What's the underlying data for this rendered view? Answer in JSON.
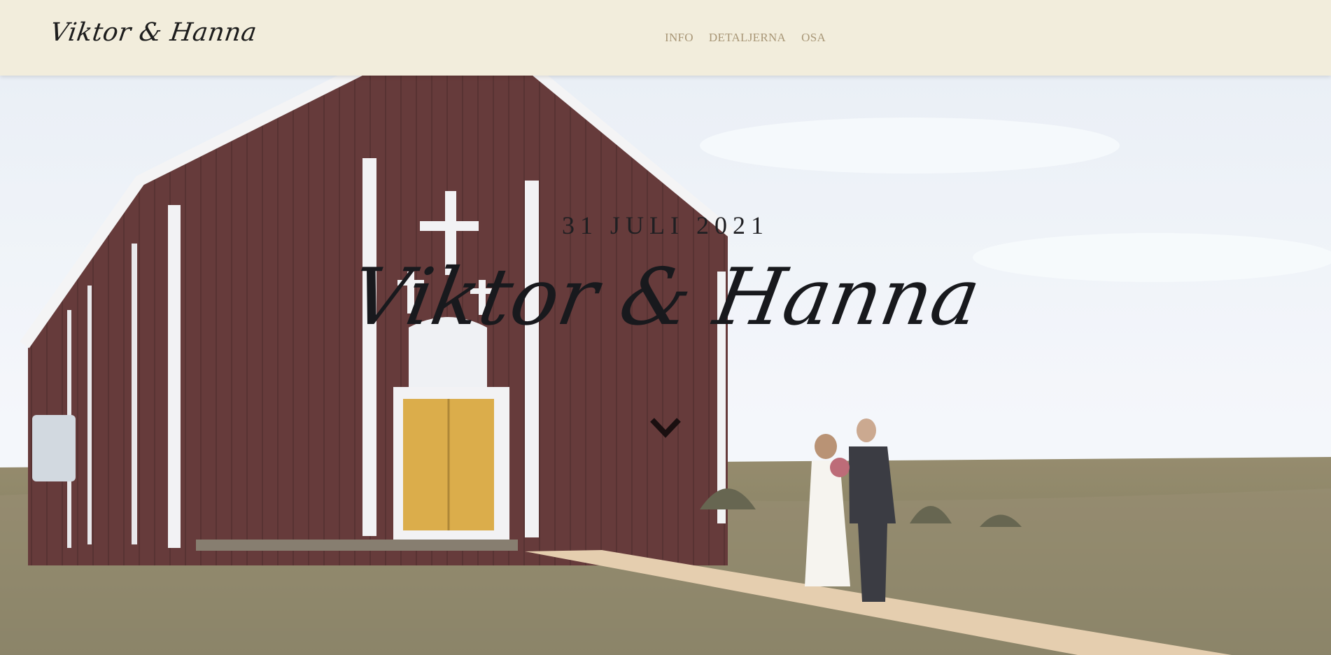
{
  "header": {
    "logo_text": "Viktor & Hanna",
    "nav": [
      {
        "label": "INFO"
      },
      {
        "label": "DETALJERNA"
      },
      {
        "label": "OSA"
      }
    ]
  },
  "hero": {
    "date": "31 JULI 2021",
    "title": "Viktor & Hanna",
    "scroll_icon": "chevron-down-icon"
  },
  "colors": {
    "header_bg": "#f2eddc",
    "nav_text": "#a89676",
    "barn_red": "#5a2a2a",
    "door_yellow": "#d9a63a",
    "sky": "#eef3f8"
  }
}
